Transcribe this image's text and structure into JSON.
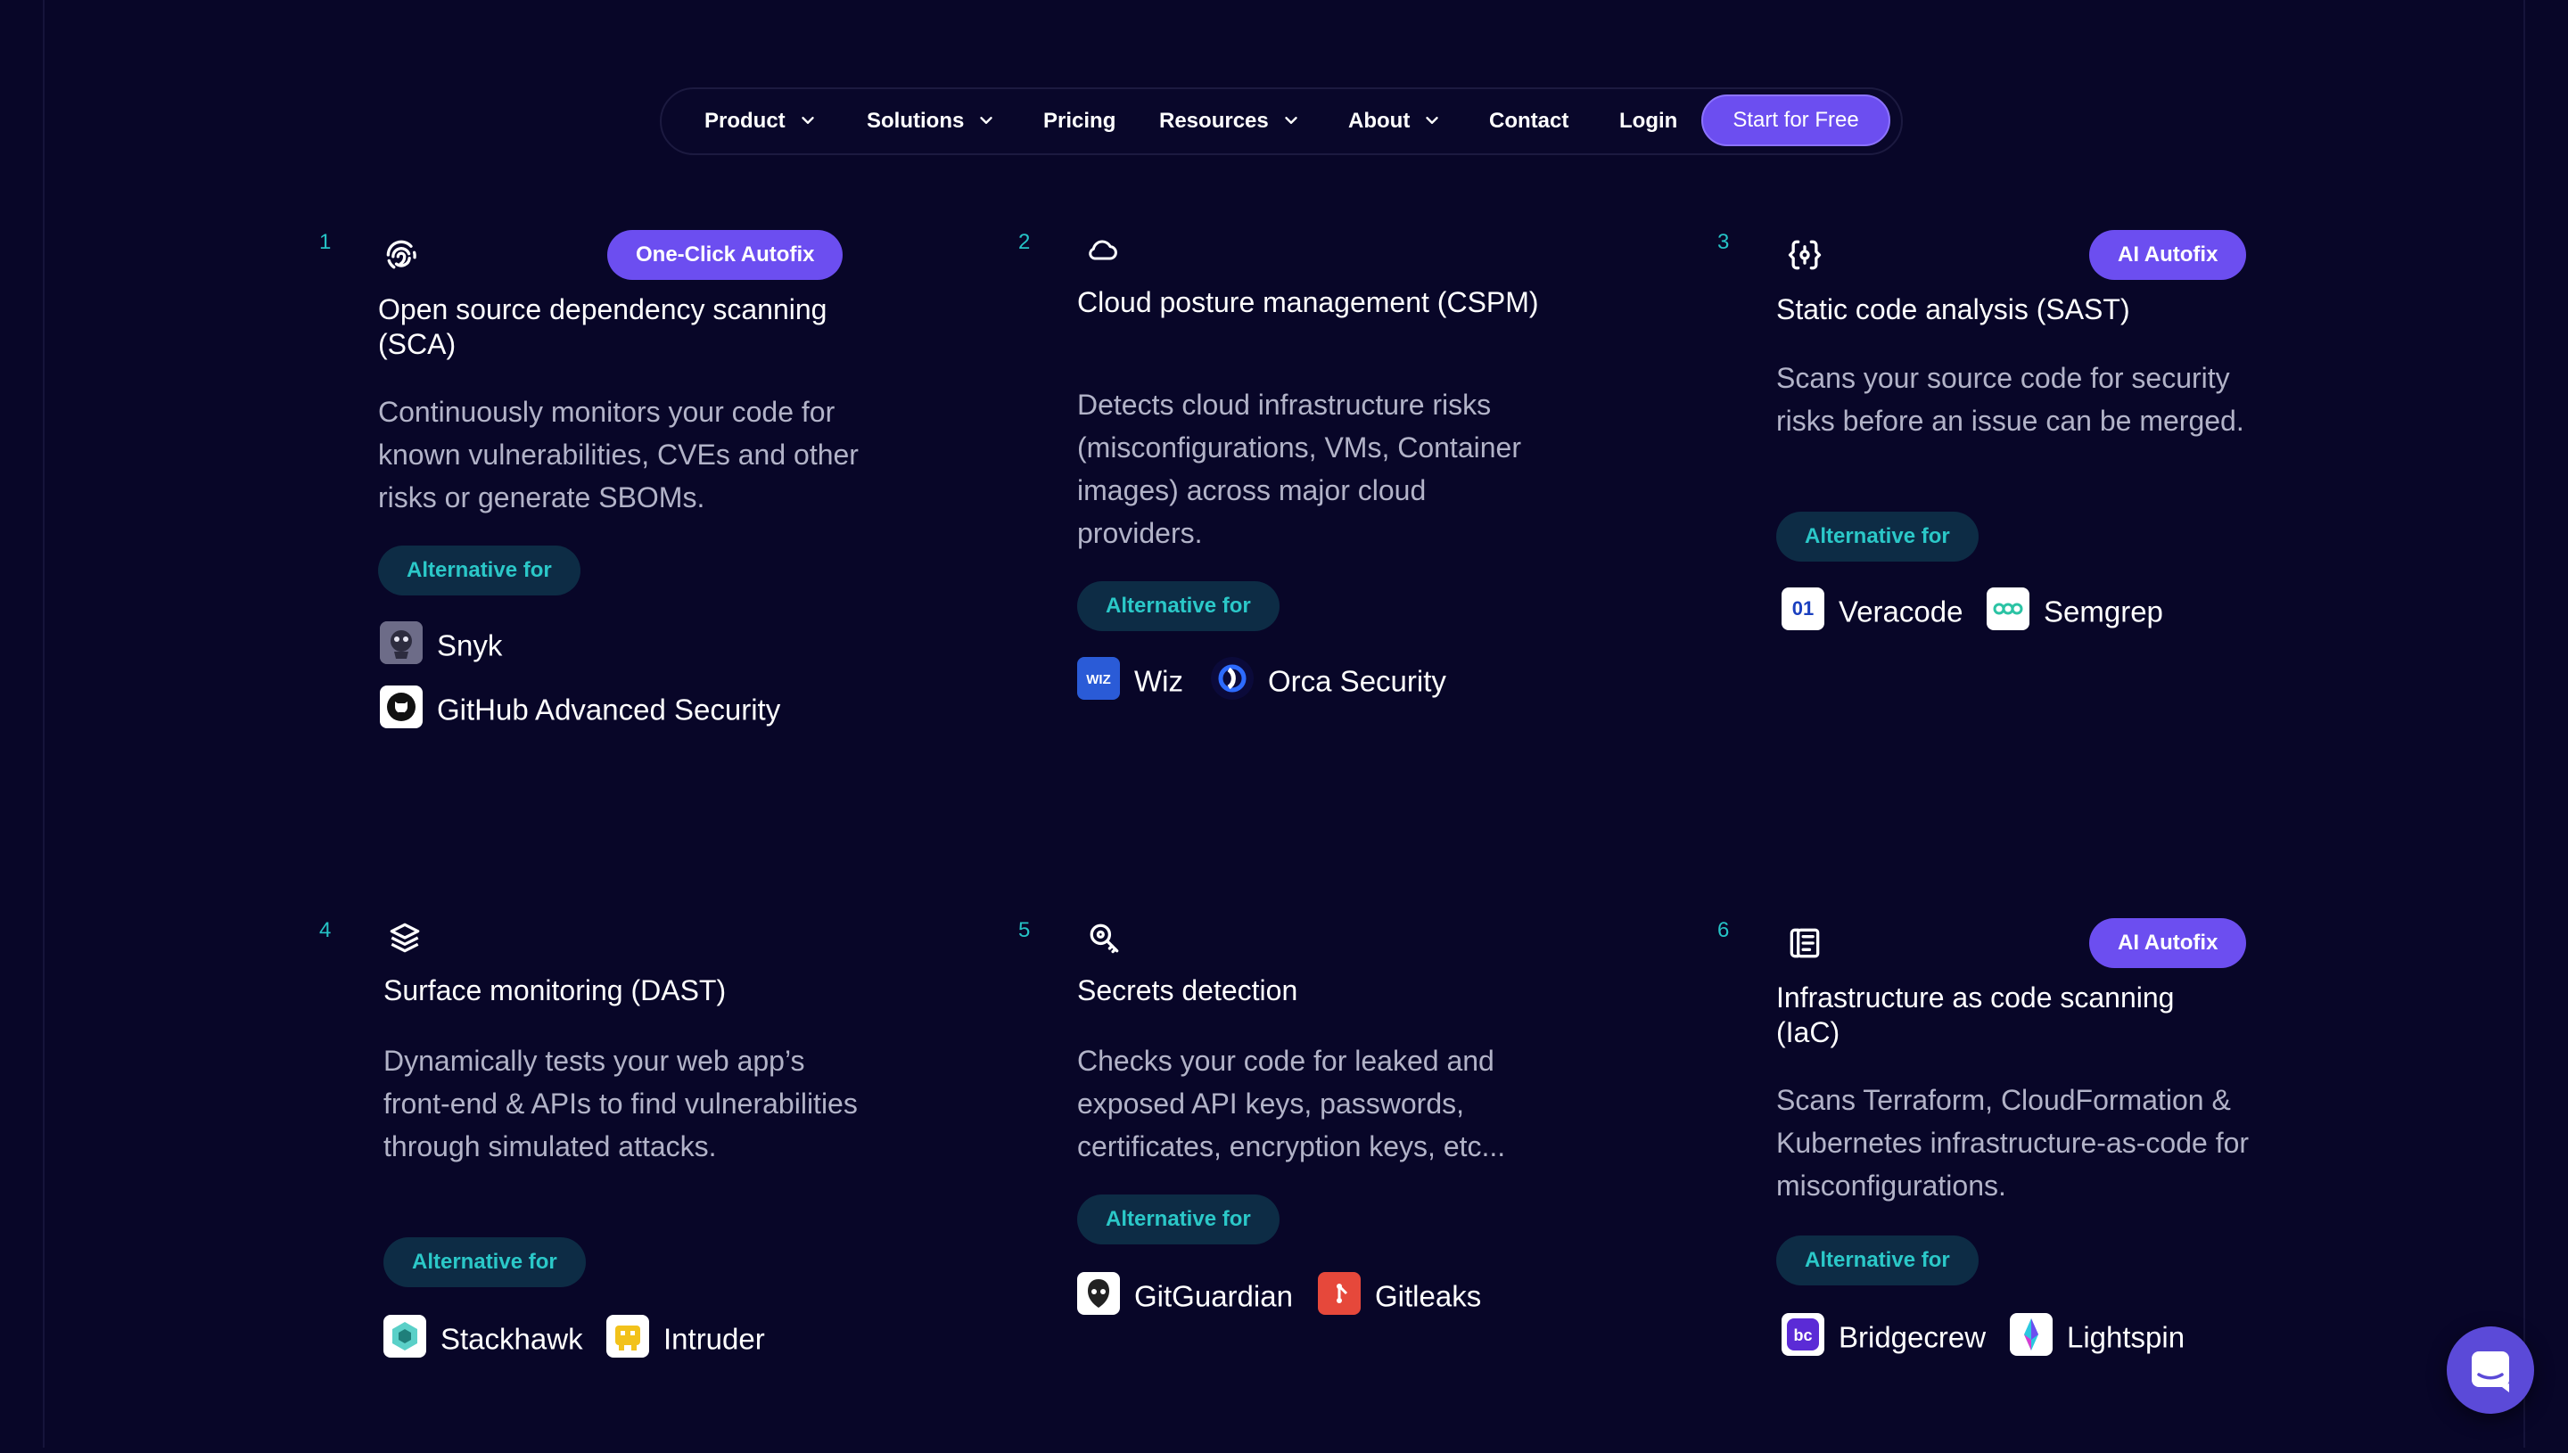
{
  "nav": {
    "items": [
      {
        "label": "Product",
        "dropdown": true
      },
      {
        "label": "Solutions",
        "dropdown": true
      },
      {
        "label": "Pricing",
        "dropdown": false
      },
      {
        "label": "Resources",
        "dropdown": true
      },
      {
        "label": "About",
        "dropdown": true
      },
      {
        "label": "Contact",
        "dropdown": false
      },
      {
        "label": "Login",
        "dropdown": false
      }
    ],
    "cta": "Start for Free"
  },
  "alternative_label": "Alternative for",
  "features": [
    {
      "number": "1",
      "icon": "fingerprint-icon",
      "badge": "One-Click Autofix",
      "title": "Open source dependency scanning (SCA)",
      "description": "Continuously monitors your code for known vulnerabilities, CVEs and other risks or generate SBOMs.",
      "alternatives": [
        "Snyk",
        "GitHub Advanced Security"
      ]
    },
    {
      "number": "2",
      "icon": "cloud-icon",
      "badge": "",
      "title": "Cloud posture management (CSPM)",
      "description": "Detects cloud infrastructure risks (misconfigurations, VMs, Container images) across major cloud providers.",
      "alternatives": [
        "Wiz",
        "Orca Security"
      ]
    },
    {
      "number": "3",
      "icon": "code-brackets-icon",
      "badge": "AI Autofix",
      "title": "Static code analysis (SAST)",
      "description": "Scans your source code for security risks before an issue can be merged.",
      "alternatives": [
        "Veracode",
        "Semgrep"
      ]
    },
    {
      "number": "4",
      "icon": "layers-icon",
      "badge": "",
      "title": "Surface monitoring (DAST)",
      "description": "Dynamically tests your web app’s front-end & APIs to find vulnerabilities through simulated attacks.",
      "alternatives": [
        "Stackhawk",
        "Intruder"
      ]
    },
    {
      "number": "5",
      "icon": "key-search-icon",
      "badge": "",
      "title": "Secrets detection",
      "description": "Checks your code for leaked and exposed API keys, passwords, certificates, encryption keys, etc...",
      "alternatives": [
        "GitGuardian",
        "Gitleaks"
      ]
    },
    {
      "number": "6",
      "icon": "infrastructure-file-icon",
      "badge": "AI Autofix",
      "title": "Infrastructure as code scanning (IaC)",
      "description": "Scans Terraform, CloudFormation & Kubernetes infrastructure-as-code for misconfigurations.",
      "alternatives": [
        "Bridgecrew",
        "Lightspin"
      ]
    }
  ],
  "colors": {
    "background": "#080628",
    "accent": "#6c4ef0",
    "teal": "#25c3c6",
    "alt_pill_bg": "#0d2c45",
    "body_text": "#b2b3c8"
  },
  "chat_widget_icon": "chat-icon"
}
